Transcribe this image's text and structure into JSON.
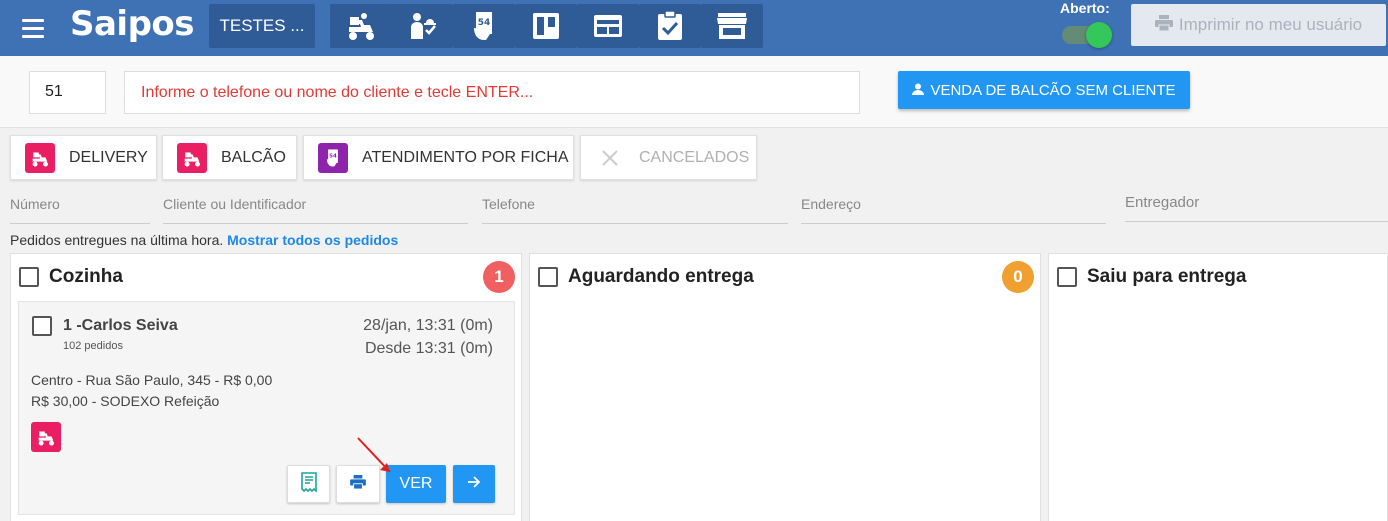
{
  "header": {
    "logo": "Saipos",
    "store_name": "TESTES ...",
    "nav_icons": [
      "delivery-scooter-icon",
      "waiter-tray-icon",
      "order-ticket-icon",
      "kanban-board-icon",
      "table-screen-icon",
      "checklist-icon",
      "store-icon"
    ],
    "status_label": "Aberto:",
    "status_open": true,
    "print_user_label": "Imprimir no meu usuário"
  },
  "search": {
    "order_number": "51",
    "client_placeholder": "Informe o telefone ou nome do cliente e tecle ENTER...",
    "counter_sale_label": "VENDA DE BALCÃO SEM CLIENTE"
  },
  "tabs": [
    {
      "label": "DELIVERY",
      "color": "#e91e63",
      "icon": "delivery-scooter-icon"
    },
    {
      "label": "BALCÃO",
      "color": "#e91e63",
      "icon": "delivery-scooter-icon"
    },
    {
      "label": "ATENDIMENTO POR FICHA",
      "color": "#8e24aa",
      "icon": "order-ticket-icon"
    },
    {
      "label": "CANCELADOS",
      "color": "#bdbdbd",
      "icon": "close-icon"
    }
  ],
  "filters": {
    "numero": "Número",
    "cliente": "Cliente ou Identificador",
    "telefone": "Telefone",
    "endereco": "Endereço",
    "entregador": "Entregador"
  },
  "info": {
    "text": "Pedidos entregues na última hora.",
    "link": "Mostrar todos os pedidos"
  },
  "columns": [
    {
      "title": "Cozinha",
      "count": "1",
      "badge_color": "#f06060"
    },
    {
      "title": "Aguardando entrega",
      "count": "0",
      "badge_color": "#f0a030"
    },
    {
      "title": "Saiu para entrega",
      "count": null,
      "badge_color": null
    }
  ],
  "order": {
    "title": "1 -Carlos Seiva",
    "orders_count": "102 pedidos",
    "date": "28/jan, 13:31 (0m)",
    "since": "Desde 13:31 (0m)",
    "address": "Centro - Rua São Paulo, 345 - R$ 0,00",
    "payment": "R$ 30,00 - SODEXO Refeição",
    "view_label": "VER"
  }
}
